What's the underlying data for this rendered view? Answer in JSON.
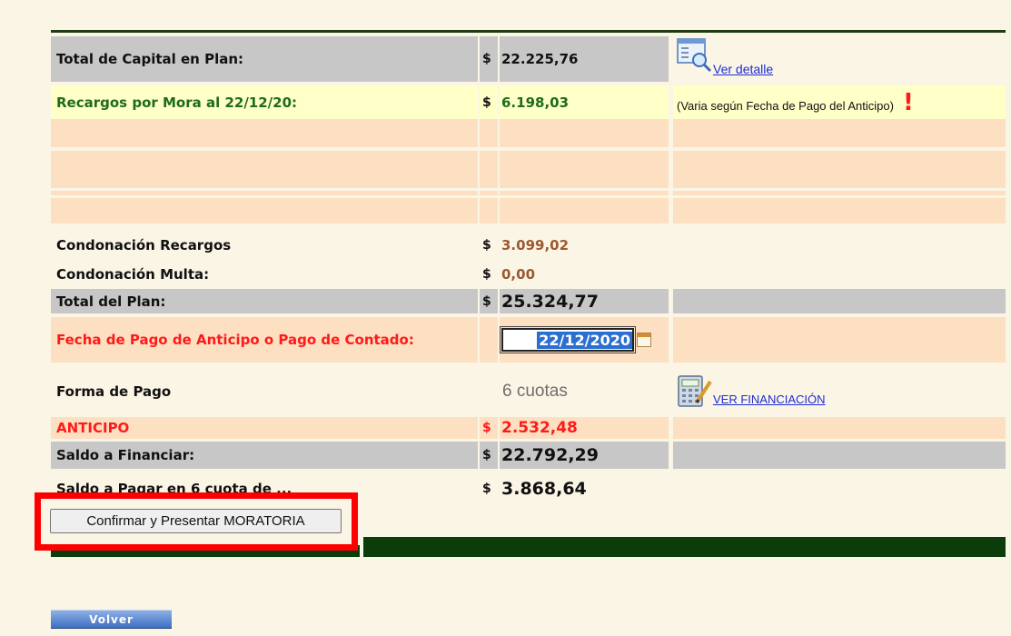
{
  "rows": {
    "capital": {
      "label": "Total de Capital en Plan:",
      "currency": "$",
      "value": "22.225,76",
      "link": "Ver detalle",
      "icon": "document-magnifier-icon"
    },
    "recargos": {
      "label": "Recargos por Mora al 22/12/20:",
      "currency": "$",
      "value": "6.198,03",
      "note": "(Varia según Fecha de Pago del Anticipo)",
      "alert": "!"
    },
    "condonacion_recargos": {
      "label": "Condonación Recargos",
      "currency": "$",
      "value": "3.099,02"
    },
    "condonacion_multa": {
      "label": "Condonación Multa:",
      "currency": "$",
      "value": "0,00"
    },
    "total_plan": {
      "label": "Total del Plan:",
      "currency": "$",
      "value": "25.324,77"
    },
    "fecha_pago": {
      "label": "Fecha de Pago de Anticipo o Pago de Contado:",
      "date_value": "22/12/2020",
      "icon": "calendar-icon"
    },
    "forma_pago": {
      "label": "Forma de Pago",
      "value": "6 cuotas",
      "link": "VER FINANCIACIÓN",
      "icon": "calculator-icon"
    },
    "anticipo": {
      "label": "ANTICIPO",
      "currency": "$",
      "value": "2.532,48"
    },
    "saldo_financiar": {
      "label": "Saldo a Financiar:",
      "currency": "$",
      "value": "22.792,29"
    },
    "saldo_pagar": {
      "label": "Saldo a Pagar en 6 cuota de ...",
      "currency": "$",
      "value": "3.868,64"
    }
  },
  "buttons": {
    "confirm": "Confirmar y Presentar MORATORIA",
    "back": "Volver"
  },
  "colors": {
    "background": "#fbf5e6",
    "gray_row": "#c7c7c7",
    "yellow_row": "#ffffc8",
    "peach_row": "#fddfc1",
    "dark_green": "#0b3d0b",
    "highlight_red": "#ff0000",
    "link_blue": "#1d2cd6"
  }
}
